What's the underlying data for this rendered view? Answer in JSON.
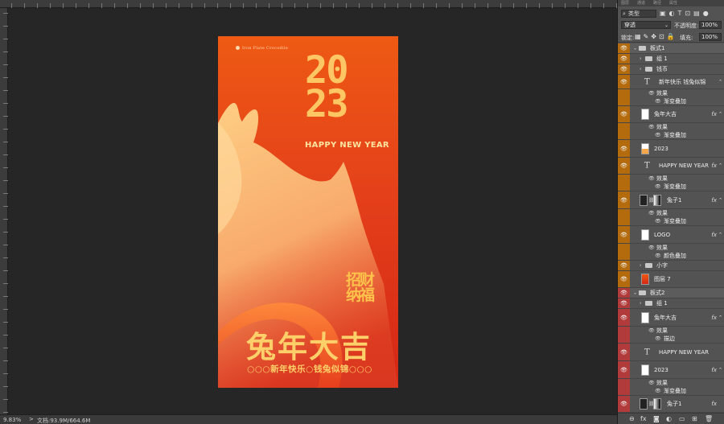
{
  "canvas": {
    "poster": {
      "brand": "Iron Plate Crocodile",
      "year_line1": "20",
      "year_line2": "23",
      "happy_new_year": "HAPPY NEW YEAR",
      "seal_line1": "招财",
      "seal_line2": "纳福",
      "title": "兔年大吉",
      "subtitle": "○○○新年快乐○钱兔似锦○○○"
    }
  },
  "status": {
    "zoom": "9.83%",
    "doc": "文档:93.9M/664.6M",
    "arrow": ">"
  },
  "panel": {
    "tabs": [
      "图层",
      "通道",
      "路径",
      "属性"
    ],
    "filter_label": "类型",
    "blend_mode": "穿透",
    "opacity_label": "不透明度:",
    "opacity_value": "100%",
    "lock_label": "锁定:",
    "fill_label": "填充:",
    "fill_value": "100%",
    "fx_label": "fx",
    "effects_label": "效果",
    "layers": {
      "group_a": "板式1",
      "group1": "组 1",
      "coins": "钱币",
      "text_greeting": "新年快乐 钱兔似锦",
      "gradient_overlay": "渐变叠加",
      "tunian": "兔年大吉",
      "y2023": "2023",
      "hny": "HAPPY NEW YEAR",
      "rabbit": "兔子1",
      "logo": "LOGO",
      "color_overlay": "颜色叠加",
      "small_text": "小字",
      "layer7": "图层 7",
      "group_b": "板式2",
      "stroke": "描边"
    }
  },
  "colors": {
    "orange_group": "#b46b0e",
    "red_group": "#b13b3b",
    "poster_top": "#ee5a14",
    "poster_bottom": "#d42716",
    "gold": "#ffc763"
  }
}
